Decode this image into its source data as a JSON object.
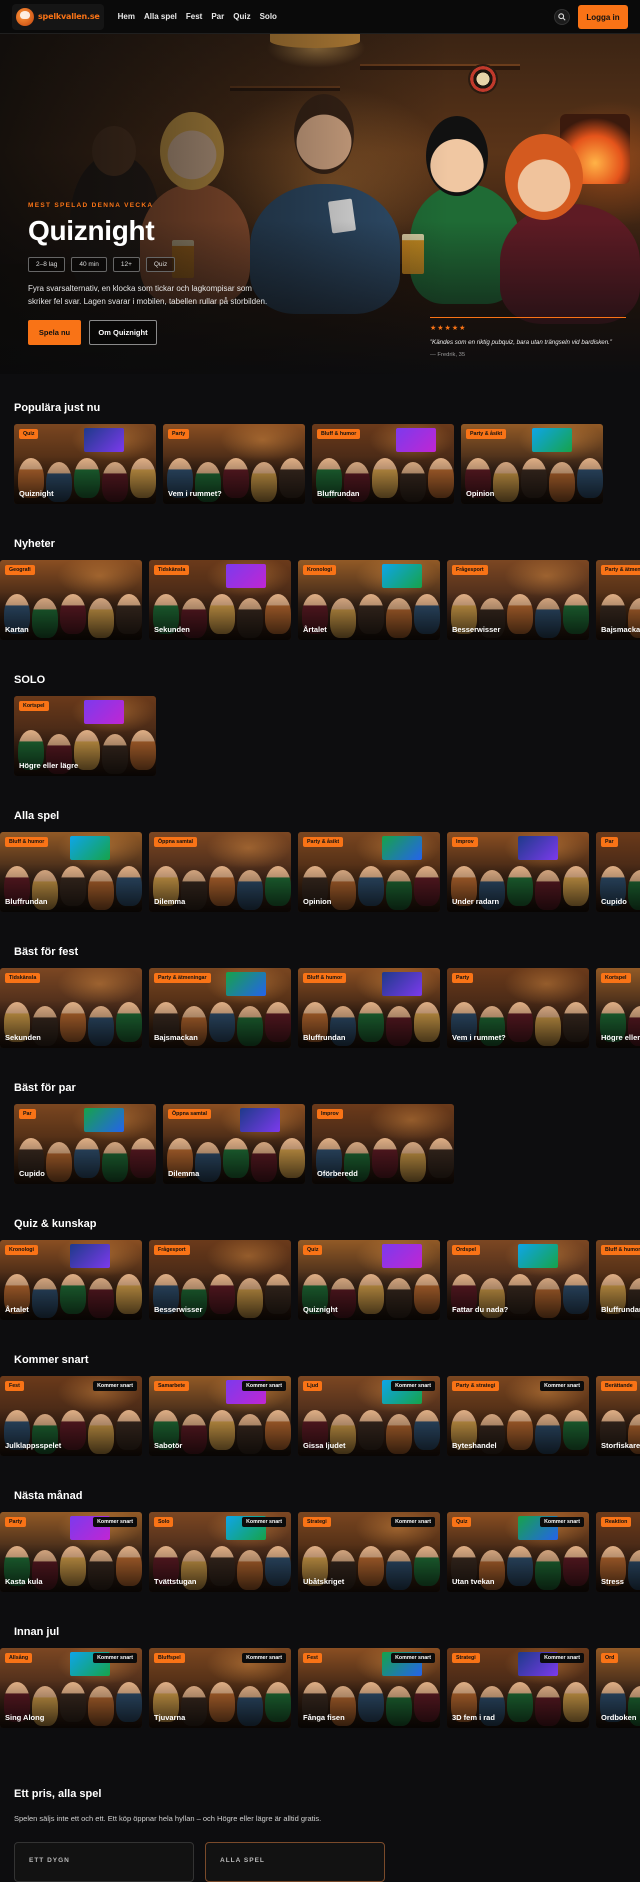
{
  "header": {
    "logo_text_a": "spelkvallen",
    "logo_text_b": ".se",
    "nav": [
      "Hem",
      "Alla spel",
      "Fest",
      "Par",
      "Quiz",
      "Solo"
    ],
    "login_label": "Logga in",
    "search_icon": "search-icon"
  },
  "hero": {
    "eyebrow": "MEST SPELAD DENNA VECKA",
    "title": "Quiznight",
    "tags": [
      "2–8 lag",
      "40 min",
      "12+",
      "Quiz"
    ],
    "description": "Fyra svarsalternativ, en klocka som tickar och lagkompisar som skriker fel svar. Lagen svarar i mobilen, tabellen rullar på storbilden.",
    "primary_label": "Spela nu",
    "secondary_label": "Om Quiznight",
    "stars": "★★★★★",
    "quote": "”Kändes som en riktig pubquiz, bara utan trängseln vid bardisken.”",
    "quote_author": "— Fredrik, 35"
  },
  "sections": [
    {
      "title": "Populära just nu",
      "offset": 14,
      "cards": [
        {
          "badge": "Quiz",
          "name": "Quiznight",
          "soon": ""
        },
        {
          "badge": "Party",
          "name": "Vem i rummet?",
          "soon": ""
        },
        {
          "badge": "Bluff & humor",
          "name": "Bluffrundan",
          "soon": ""
        },
        {
          "badge": "Party & åsikt",
          "name": "Opinion",
          "soon": ""
        }
      ]
    },
    {
      "title": "Nyheter",
      "offset": 0,
      "cards": [
        {
          "badge": "Geografi",
          "name": "Kartan",
          "soon": ""
        },
        {
          "badge": "Tidskänsla",
          "name": "Sekunden",
          "soon": ""
        },
        {
          "badge": "Kronologi",
          "name": "Årtalet",
          "soon": ""
        },
        {
          "badge": "Frågesport",
          "name": "Besserwisser",
          "soon": ""
        },
        {
          "badge": "Party & ätmeningar",
          "name": "Bajsmackan",
          "soon": ""
        }
      ]
    },
    {
      "title": "SOLO",
      "offset": 14,
      "cards": [
        {
          "badge": "Kortspel",
          "name": "Högre eller lägre",
          "soon": ""
        }
      ]
    },
    {
      "title": "Alla spel",
      "offset": 0,
      "cards": [
        {
          "badge": "Bluff & humor",
          "name": "Bluffrundan",
          "soon": ""
        },
        {
          "badge": "Öppna samtal",
          "name": "Dilemma",
          "soon": ""
        },
        {
          "badge": "Party & åsikt",
          "name": "Opinion",
          "soon": ""
        },
        {
          "badge": "Improv",
          "name": "Under radarn",
          "soon": ""
        },
        {
          "badge": "Par",
          "name": "Cupido",
          "soon": ""
        }
      ]
    },
    {
      "title": "Bäst för fest",
      "offset": 0,
      "cards": [
        {
          "badge": "Tidskänsla",
          "name": "Sekunden",
          "soon": ""
        },
        {
          "badge": "Party & ätmeningar",
          "name": "Bajsmackan",
          "soon": ""
        },
        {
          "badge": "Bluff & humor",
          "name": "Bluffrundan",
          "soon": ""
        },
        {
          "badge": "Party",
          "name": "Vem i rummet?",
          "soon": ""
        },
        {
          "badge": "Kortspel",
          "name": "Högre eller lägre",
          "soon": ""
        }
      ]
    },
    {
      "title": "Bäst för par",
      "offset": 14,
      "cards": [
        {
          "badge": "Par",
          "name": "Cupido",
          "soon": ""
        },
        {
          "badge": "Öppna samtal",
          "name": "Dilemma",
          "soon": ""
        },
        {
          "badge": "Improv",
          "name": "Oförberedd",
          "soon": ""
        }
      ]
    },
    {
      "title": "Quiz & kunskap",
      "offset": 0,
      "cards": [
        {
          "badge": "Kronologi",
          "name": "Årtalet",
          "soon": ""
        },
        {
          "badge": "Frågesport",
          "name": "Besserwisser",
          "soon": ""
        },
        {
          "badge": "Quiz",
          "name": "Quiznight",
          "soon": ""
        },
        {
          "badge": "Ordspel",
          "name": "Fattar du nada?",
          "soon": ""
        },
        {
          "badge": "Bluff & humor",
          "name": "Bluffrundan",
          "soon": ""
        }
      ]
    },
    {
      "title": "Kommer snart",
      "offset": 0,
      "cards": [
        {
          "badge": "Fest",
          "name": "Julklappsspelet",
          "soon": "Kommer snart"
        },
        {
          "badge": "Samarbete",
          "name": "Sabotör",
          "soon": "Kommer snart"
        },
        {
          "badge": "Ljud",
          "name": "Gissa ljudet",
          "soon": "Kommer snart"
        },
        {
          "badge": "Party & strategi",
          "name": "Byteshandel",
          "soon": "Kommer snart"
        },
        {
          "badge": "Berättande",
          "name": "Storfiskaren",
          "soon": ""
        }
      ]
    },
    {
      "title": "Nästa månad",
      "offset": 0,
      "cards": [
        {
          "badge": "Party",
          "name": "Kasta kula",
          "soon": "Kommer snart"
        },
        {
          "badge": "Solo",
          "name": "Tvättstugan",
          "soon": "Kommer snart"
        },
        {
          "badge": "Strategi",
          "name": "Ubåtskriget",
          "soon": "Kommer snart"
        },
        {
          "badge": "Quiz",
          "name": "Utan tvekan",
          "soon": "Kommer snart"
        },
        {
          "badge": "Reaktion",
          "name": "Stress",
          "soon": ""
        }
      ]
    },
    {
      "title": "Innan jul",
      "offset": 0,
      "cards": [
        {
          "badge": "Allsång",
          "name": "Sing Along",
          "soon": "Kommer snart"
        },
        {
          "badge": "Bluffspel",
          "name": "Tjuvarna",
          "soon": "Kommer snart"
        },
        {
          "badge": "Fest",
          "name": "Fånga fisen",
          "soon": "Kommer snart"
        },
        {
          "badge": "Strategi",
          "name": "3D fem i rad",
          "soon": "Kommer snart"
        },
        {
          "badge": "Ord",
          "name": "Ordboken",
          "soon": ""
        }
      ]
    }
  ],
  "pricing": {
    "title": "Ett pris, alla spel",
    "subtitle": "Spelen säljs inte ett och ett. Ett köp öppnar hela hyllan – och Högre eller lägre är alltid gratis.",
    "plan_a": "ETT DYGN",
    "plan_b": "ALLA SPEL"
  },
  "colors": {
    "accent": "#f97316",
    "background": "#0d0d0f"
  }
}
